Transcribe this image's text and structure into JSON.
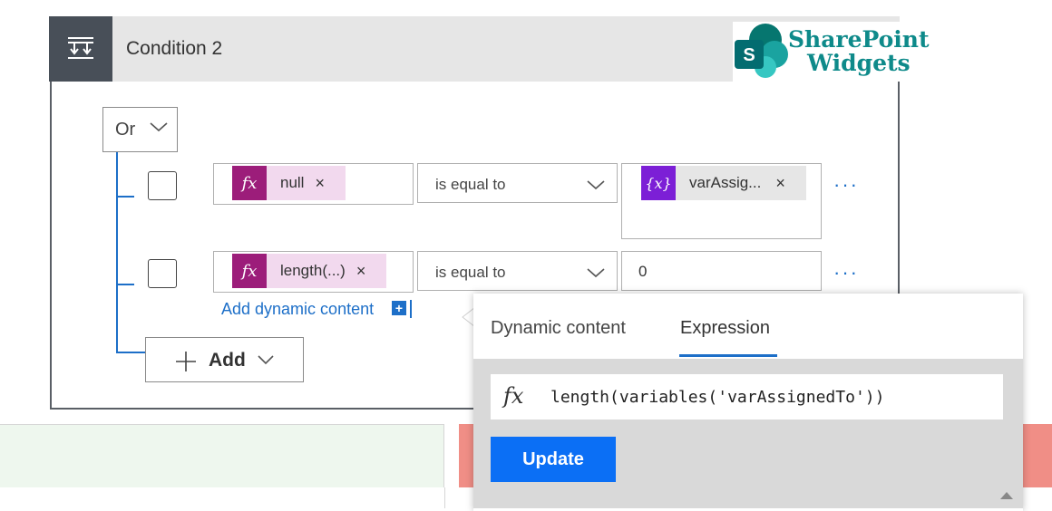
{
  "header": {
    "title": "Condition 2",
    "icon": "condition-icon"
  },
  "logo": {
    "line1": "SharePoint",
    "line2": "Widgets",
    "badge": "S"
  },
  "group": {
    "operator": "Or"
  },
  "rows": [
    {
      "token_label": "null",
      "operator": "is equal to",
      "value_token": "varAssig...",
      "more": "···"
    },
    {
      "token_label": "length(...)",
      "operator": "is equal to",
      "value": "0",
      "more": "···"
    }
  ],
  "add_dynamic_label": "Add dynamic content",
  "add_button": "Add",
  "popup": {
    "tabs": [
      "Dynamic content",
      "Expression"
    ],
    "active_tab": "Expression",
    "expression": "length(variables('varAssignedTo'))",
    "update_label": "Update"
  },
  "colors": {
    "expression_token": "#9c1d7a",
    "variable_token": "#7c1fd6",
    "link": "#1d6fc8",
    "update_button": "#0b6ff5",
    "if_yes": "#eef7ee",
    "if_no": "#f08e86"
  }
}
